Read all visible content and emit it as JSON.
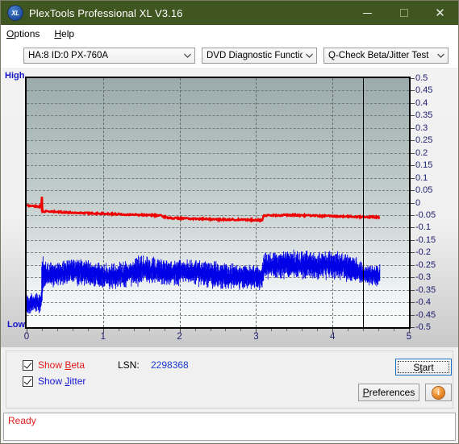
{
  "window": {
    "title": "PlexTools Professional XL V3.16",
    "icon": "xl-logo-icon",
    "icon_text": "XL",
    "titlebar_color": "#3f5620",
    "minimize_label": "─",
    "maximize_label": "□",
    "close_label": "✕"
  },
  "menubar": {
    "items": [
      {
        "label": "Options",
        "accel": "O"
      },
      {
        "label": "Help",
        "accel": "H"
      }
    ]
  },
  "toolbar": {
    "drive_select": {
      "value": "HA:8 ID:0  PX-760A",
      "icon": "chevron-down-icon"
    },
    "function_select": {
      "value": "DVD Diagnostic Functions",
      "icon": "chevron-down-icon"
    },
    "test_select": {
      "value": "Q-Check Beta/Jitter Test",
      "icon": "chevron-down-icon"
    }
  },
  "controls": {
    "show_beta": {
      "label": "Show Beta",
      "accel": "B",
      "checked": true,
      "color": "#e01b1b"
    },
    "show_jitter": {
      "label": "Show Jitter",
      "accel": "J",
      "checked": true,
      "color": "#1414d2"
    },
    "lsn_label": "LSN:",
    "lsn_value": "2298368",
    "start_label": "Start",
    "preferences_label": "Preferences",
    "info_label": "i",
    "info_icon": "info-icon"
  },
  "statusbar": {
    "text": "Ready",
    "color": "#e01b1b"
  },
  "chart_data": {
    "type": "line",
    "title": "Q-Check Beta/Jitter Test",
    "xlabel": "",
    "ylabel": "",
    "xlim": [
      0,
      5
    ],
    "ylim": [
      -0.5,
      0.5
    ],
    "grid": true,
    "legend_position": "bottom-left-checkboxes",
    "x_ticks": [
      0,
      1,
      2,
      3,
      4,
      5
    ],
    "x_tick_labels": [
      "0",
      "1",
      "2",
      "3",
      "4",
      "5"
    ],
    "x_minor_tick_step": 0.2,
    "y_ticks": [
      0.5,
      0.45,
      0.4,
      0.35,
      0.3,
      0.25,
      0.2,
      0.15,
      0.1,
      0.05,
      0,
      -0.05,
      -0.1,
      -0.15,
      -0.2,
      -0.25,
      -0.3,
      -0.35,
      -0.4,
      -0.45,
      -0.5
    ],
    "y_tick_labels": [
      "0.5",
      "0.45",
      "0.4",
      "0.35",
      "0.3",
      "0.25",
      "0.2",
      "0.15",
      "0.1",
      "0.05",
      "0",
      "-0.05",
      "-0.1",
      "-0.15",
      "-0.2",
      "-0.25",
      "-0.3",
      "-0.35",
      "-0.4",
      "-0.45",
      "-0.5"
    ],
    "axis_left_label_top": "High",
    "axis_left_label_bottom": "Low",
    "plot_bg_top_color": "#9babab",
    "plot_bg_bottom_color": "#fbfdfd",
    "cursor_marker_x": 4.4,
    "series": [
      {
        "name": "Beta",
        "color": "#ee0000",
        "noise": 0.006,
        "points": [
          [
            0.0,
            -0.012
          ],
          [
            0.05,
            -0.013
          ],
          [
            0.1,
            -0.014
          ],
          [
            0.15,
            -0.015
          ],
          [
            0.19,
            -0.016
          ],
          [
            0.2,
            0.022
          ],
          [
            0.205,
            -0.033
          ],
          [
            0.23,
            -0.035
          ],
          [
            0.3,
            -0.036
          ],
          [
            0.45,
            -0.038
          ],
          [
            0.6,
            -0.04
          ],
          [
            0.8,
            -0.042
          ],
          [
            1.0,
            -0.044
          ],
          [
            1.2,
            -0.046
          ],
          [
            1.4,
            -0.048
          ],
          [
            1.6,
            -0.05
          ],
          [
            1.75,
            -0.052
          ],
          [
            1.85,
            -0.061
          ],
          [
            2.0,
            -0.063
          ],
          [
            2.2,
            -0.065
          ],
          [
            2.45,
            -0.067
          ],
          [
            2.7,
            -0.068
          ],
          [
            2.9,
            -0.069
          ],
          [
            3.08,
            -0.07
          ],
          [
            3.1,
            -0.052
          ],
          [
            3.25,
            -0.051
          ],
          [
            3.45,
            -0.05
          ],
          [
            3.6,
            -0.051
          ],
          [
            3.8,
            -0.053
          ],
          [
            4.0,
            -0.054
          ],
          [
            4.2,
            -0.056
          ],
          [
            4.4,
            -0.057
          ],
          [
            4.55,
            -0.058
          ],
          [
            4.62,
            -0.059
          ]
        ]
      },
      {
        "name": "Jitter",
        "color": "#0000e6",
        "band": true,
        "points": [
          [
            0.0,
            -0.405,
            0.03
          ],
          [
            0.05,
            -0.408,
            0.032
          ],
          [
            0.1,
            -0.404,
            0.03
          ],
          [
            0.15,
            -0.402,
            0.031
          ],
          [
            0.19,
            -0.4,
            0.03
          ],
          [
            0.2,
            -0.3,
            0.095
          ],
          [
            0.22,
            -0.292,
            0.042
          ],
          [
            0.3,
            -0.288,
            0.038
          ],
          [
            0.4,
            -0.285,
            0.04
          ],
          [
            0.5,
            -0.28,
            0.04
          ],
          [
            0.6,
            -0.272,
            0.04
          ],
          [
            0.7,
            -0.276,
            0.042
          ],
          [
            0.8,
            -0.285,
            0.04
          ],
          [
            0.95,
            -0.292,
            0.038
          ],
          [
            1.1,
            -0.295,
            0.038
          ],
          [
            1.25,
            -0.29,
            0.04
          ],
          [
            1.4,
            -0.282,
            0.042
          ],
          [
            1.5,
            -0.268,
            0.045
          ],
          [
            1.6,
            -0.272,
            0.042
          ],
          [
            1.75,
            -0.278,
            0.04
          ],
          [
            1.9,
            -0.282,
            0.04
          ],
          [
            2.05,
            -0.276,
            0.04
          ],
          [
            2.2,
            -0.28,
            0.04
          ],
          [
            2.4,
            -0.288,
            0.04
          ],
          [
            2.55,
            -0.292,
            0.04
          ],
          [
            2.7,
            -0.296,
            0.038
          ],
          [
            2.85,
            -0.298,
            0.038
          ],
          [
            3.0,
            -0.3,
            0.038
          ],
          [
            3.08,
            -0.302,
            0.036
          ],
          [
            3.1,
            -0.252,
            0.042
          ],
          [
            3.25,
            -0.25,
            0.042
          ],
          [
            3.45,
            -0.248,
            0.042
          ],
          [
            3.6,
            -0.25,
            0.042
          ],
          [
            3.8,
            -0.252,
            0.042
          ],
          [
            4.0,
            -0.25,
            0.042
          ],
          [
            4.15,
            -0.255,
            0.042
          ],
          [
            4.3,
            -0.268,
            0.038
          ],
          [
            4.4,
            -0.285,
            0.034
          ],
          [
            4.5,
            -0.295,
            0.032
          ],
          [
            4.6,
            -0.292,
            0.032
          ],
          [
            4.62,
            -0.29,
            0.034
          ]
        ]
      }
    ]
  }
}
